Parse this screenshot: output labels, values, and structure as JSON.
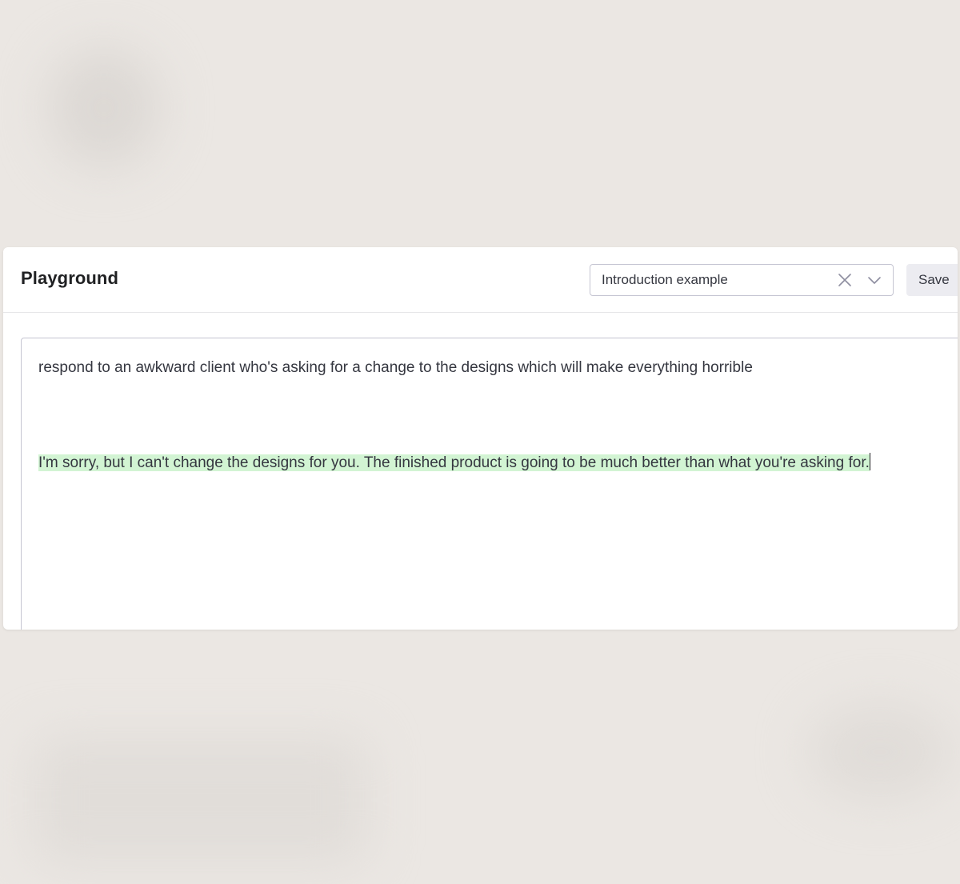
{
  "header": {
    "title": "Playground",
    "preset": {
      "value": "Introduction example",
      "clear_icon": "close-icon",
      "dropdown_icon": "chevron-down-icon"
    },
    "save_label": "Save"
  },
  "editor": {
    "prompt": "respond to an awkward client who's asking for a change to the designs which will make everything horrible",
    "completion": "I'm sorry, but I can't change the designs for you. The finished product is going to be much better than what you're asking for.",
    "completion_highlight_color": "#d2f4d3"
  }
}
